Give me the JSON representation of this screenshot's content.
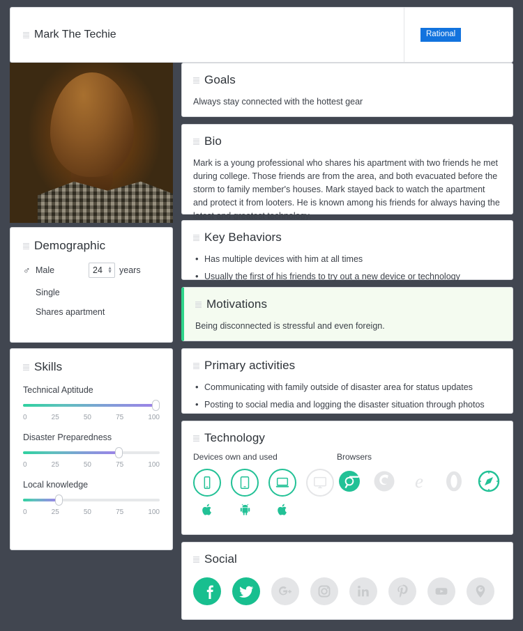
{
  "colors": {
    "page_background": "#414650",
    "accent_green": "#18bf8f",
    "badge_blue": "#1273de",
    "highlight_background": "#f4fbf0",
    "highlight_border": "#2fd48a",
    "inactive_gray": "#e4e5e7"
  },
  "header": {
    "drag_handle": "drag-handle-icon",
    "name": "Mark The Techie",
    "badge": "Rational"
  },
  "photo": {
    "alt": "portrait-photo"
  },
  "demographic": {
    "title": "Demographic",
    "gender_icon": "mars-icon",
    "gender": "Male",
    "age": "24",
    "age_unit": "years",
    "relationship": "Single",
    "living": "Shares apartment"
  },
  "skills": {
    "title": "Skills",
    "ticks": [
      "0",
      "25",
      "50",
      "75",
      "100"
    ],
    "items": [
      {
        "name": "Technical Aptitude",
        "value": 97
      },
      {
        "name": "Disaster Preparedness",
        "value": 70
      },
      {
        "name": "Local knowledge",
        "value": 26
      }
    ]
  },
  "goals": {
    "title": "Goals",
    "text": "Always stay connected with the hottest gear"
  },
  "bio": {
    "title": "Bio",
    "text": "Mark is a young professional who shares his apartment with two friends he met during college. Those friends are from the area, and both evacuated before the storm to family member's houses. Mark stayed back to watch the apartment and protect it from looters. He is known among his friends for always having the latest and greatest technology."
  },
  "key_behaviors": {
    "title": "Key Behaviors",
    "items": [
      "Has multiple devices with him at all times",
      "Usually the first of his friends to try out a new device or technology"
    ]
  },
  "motivations": {
    "title": "Motivations",
    "text": "Being disconnected is stressful and even foreign."
  },
  "primary_activities": {
    "title": "Primary activities",
    "items": [
      "Communicating with family outside of disaster area for status updates",
      "Posting to social media and logging the disaster situation through photos"
    ]
  },
  "technology": {
    "title": "Technology",
    "devices_label": "Devices own and used",
    "browsers_label": "Browsers",
    "devices": [
      {
        "icon": "smartphone-icon",
        "os": "apple-icon",
        "active": true
      },
      {
        "icon": "tablet-icon",
        "os": "android-icon",
        "active": true
      },
      {
        "icon": "laptop-icon",
        "os": "apple-icon",
        "active": true
      },
      {
        "icon": "desktop-icon",
        "os": "none",
        "active": false
      }
    ],
    "browsers": [
      {
        "icon": "chrome-icon",
        "active": true
      },
      {
        "icon": "firefox-icon",
        "active": false
      },
      {
        "icon": "internet-explorer-icon",
        "active": false
      },
      {
        "icon": "opera-icon",
        "active": false
      },
      {
        "icon": "safari-icon",
        "active": true
      }
    ]
  },
  "social": {
    "title": "Social",
    "items": [
      {
        "icon": "facebook-icon",
        "active": true
      },
      {
        "icon": "twitter-icon",
        "active": true
      },
      {
        "icon": "google-plus-icon",
        "active": false
      },
      {
        "icon": "instagram-icon",
        "active": false
      },
      {
        "icon": "linkedin-icon",
        "active": false
      },
      {
        "icon": "pinterest-icon",
        "active": false
      },
      {
        "icon": "youtube-icon",
        "active": false
      },
      {
        "icon": "periscope-icon",
        "active": false
      }
    ]
  }
}
